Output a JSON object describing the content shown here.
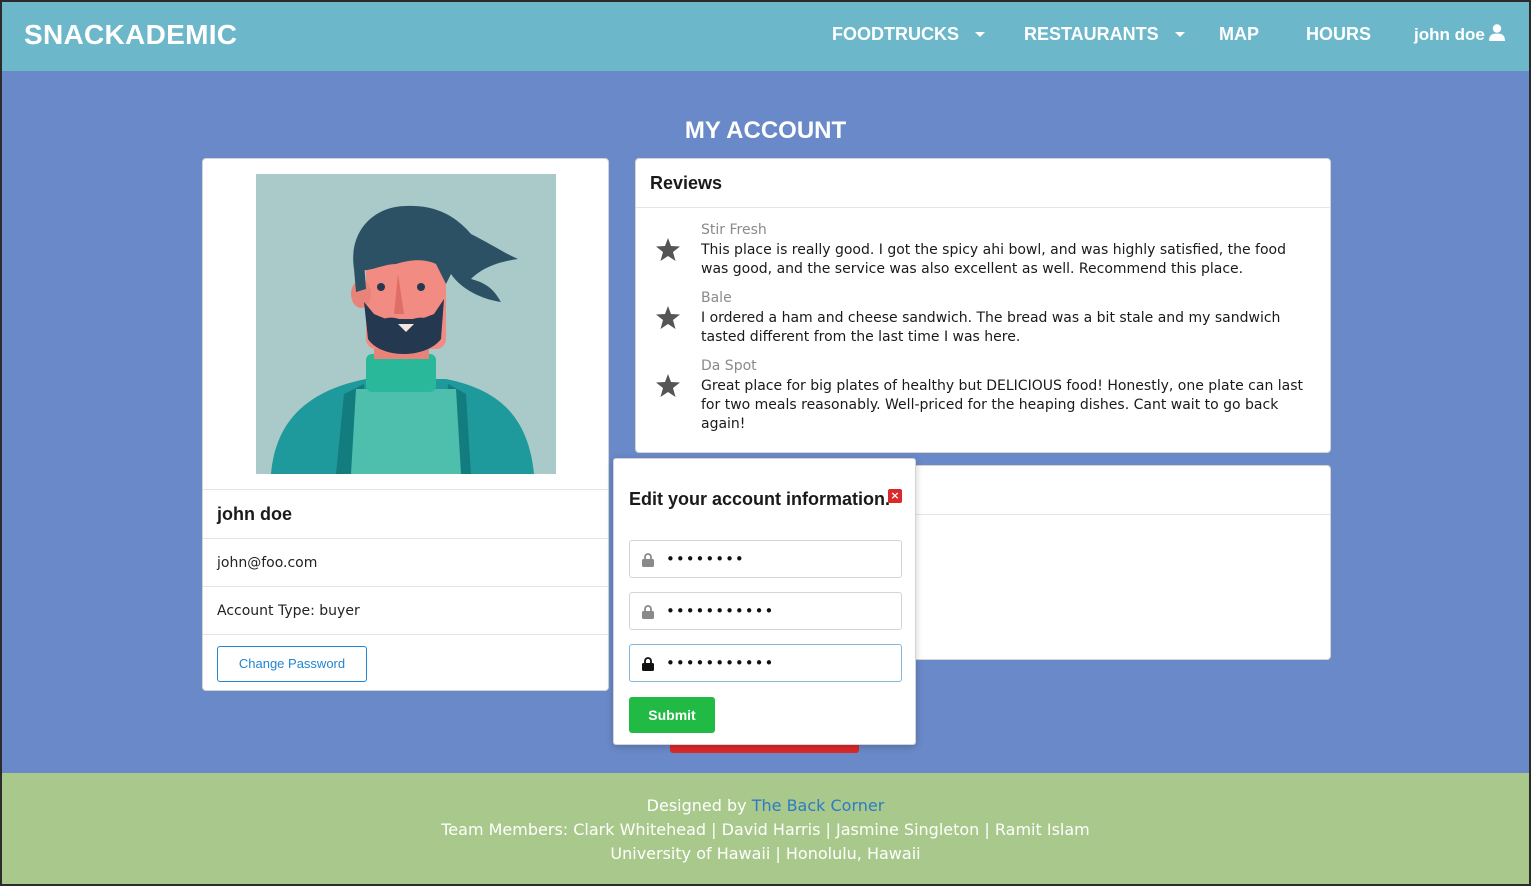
{
  "navbar": {
    "brand": "SNACKADEMIC",
    "items": [
      {
        "label": "FOODTRUCKS"
      },
      {
        "label": "RESTAURANTS"
      },
      {
        "label": "MAP"
      },
      {
        "label": "HOURS"
      }
    ],
    "user": "john doe"
  },
  "page": {
    "title": "MY ACCOUNT"
  },
  "profile": {
    "name": "john doe",
    "email": "john@foo.com",
    "account_type": "Account Type: buyer",
    "change_password_label": "Change Password"
  },
  "reviews": {
    "header": "Reviews",
    "items": [
      {
        "name": "Stir Fresh",
        "text": "This place is really good. I got the spicy ahi bowl, and was highly satisfied, the food was good, and the service was also excellent as well. Recommend this place."
      },
      {
        "name": "Bale",
        "text": "I ordered a ham and cheese sandwich. The bread was a bit stale and my sandwich tasted different from the last time I was here."
      },
      {
        "name": "Da Spot",
        "text": "Great place for big plates of healthy but DELICIOUS food! Honestly, one plate can last for two meals reasonably. Well-priced for the heaping dishes. Cant wait to go back again!"
      }
    ]
  },
  "modal": {
    "title": "Edit your account information.",
    "fields": [
      {
        "value": "••••••••"
      },
      {
        "value": "•••••••••••"
      },
      {
        "value": "•••••••••••"
      }
    ],
    "submit_label": "Submit"
  },
  "footer": {
    "designed_by_prefix": "Designed by ",
    "designed_by_link": "The Back Corner",
    "team": "Team Members: Clark Whitehead | David Harris | Jasmine Singleton | Ramit Islam",
    "location": "University of Hawaii | Honolulu, Hawaii"
  },
  "colors": {
    "navbar": "#6cb8ca",
    "background": "#6a89c9",
    "footer": "#a8c98b",
    "submit": "#21ba45",
    "danger": "#db2828",
    "link": "#2185d0"
  }
}
